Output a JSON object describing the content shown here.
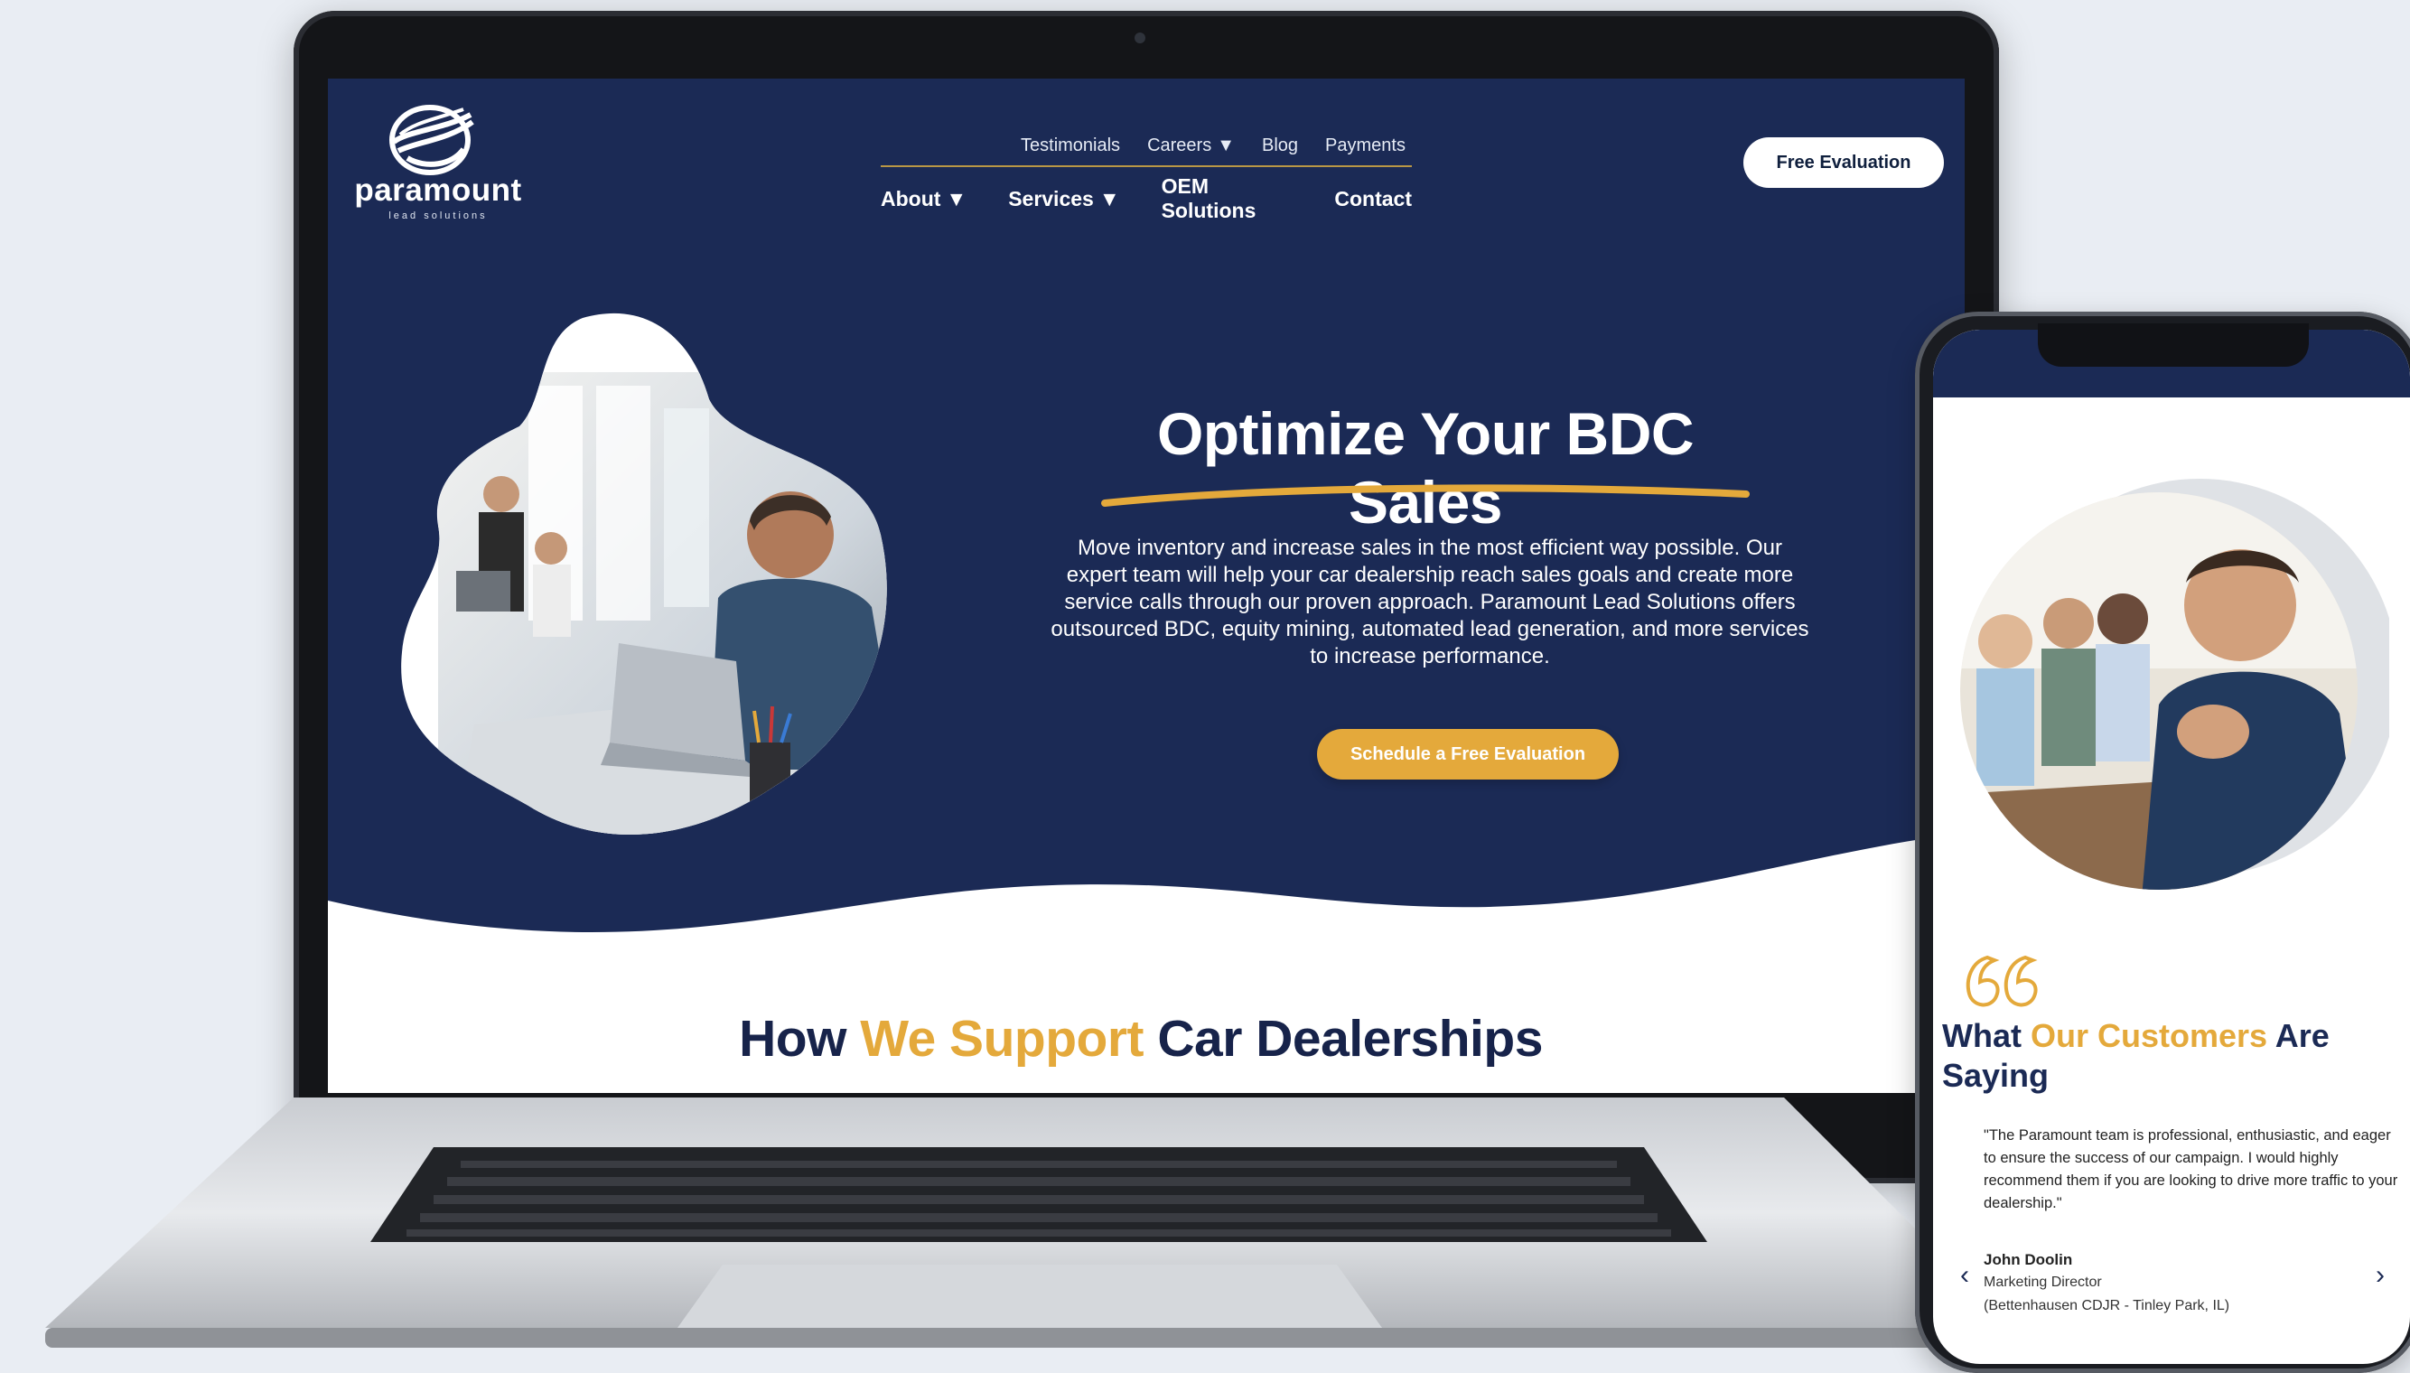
{
  "brand": {
    "name": "paramount",
    "tagline": "lead solutions"
  },
  "nav": {
    "top": [
      "Testimonials",
      "Careers",
      "Blog",
      "Payments"
    ],
    "main": [
      "About",
      "Services",
      "OEM Solutions",
      "Contact"
    ],
    "cta": "Free Evaluation"
  },
  "hero": {
    "title": "Optimize Your BDC Sales",
    "body": "Move inventory and increase sales in the most efficient way possible. Our expert team will help your car dealership reach sales goals and create more service calls through our proven approach. Paramount Lead Solutions offers outsourced BDC, equity mining, automated lead generation, and more services to increase performance.",
    "cta": "Schedule a Free Evaluation"
  },
  "support": {
    "part1": "How ",
    "accent": "We Support",
    "part2": " Car Dealerships"
  },
  "mobile": {
    "title_part1": "What ",
    "title_accent": "Our Customers",
    "title_part2": " Are Saying",
    "quote": "\"The Paramount team is professional, enthusiastic, and eager to ensure the success of our campaign. I would highly recommend them if you are looking to drive more traffic to your dealership.\"",
    "author_name": "John Doolin",
    "author_role": "Marketing Director",
    "author_company": "(Bettenhausen CDJR - Tinley Park, IL)"
  },
  "colors": {
    "navy": "#1b2a55",
    "gold": "#e4a93b",
    "white": "#ffffff"
  },
  "icons": {
    "caret": "chevron-down-icon",
    "quote": "quote-icon",
    "prev": "chevron-left-icon",
    "next": "chevron-right-icon"
  }
}
